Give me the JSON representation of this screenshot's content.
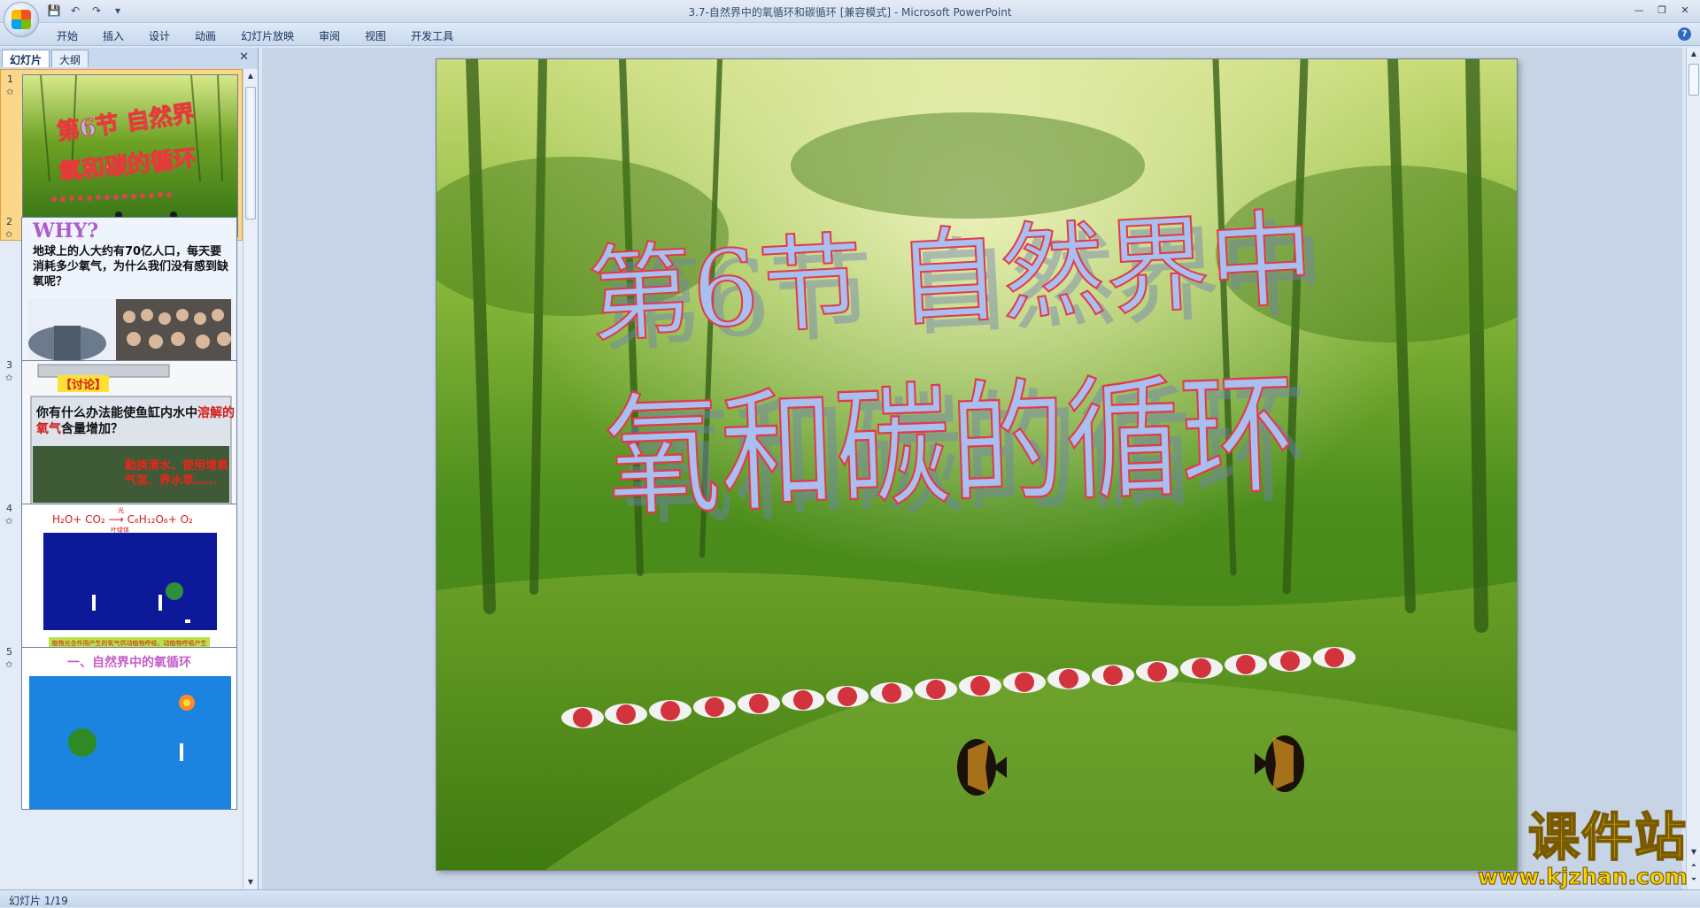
{
  "window": {
    "title": "3.7-自然界中的氧循环和碳循环 [兼容模式] - Microsoft PowerPoint"
  },
  "ribbon": {
    "tabs": [
      "开始",
      "插入",
      "设计",
      "动画",
      "幻灯片放映",
      "审阅",
      "视图",
      "开发工具"
    ]
  },
  "left_pane": {
    "tabs": [
      "幻灯片",
      "大纲"
    ],
    "slides": [
      {
        "num": "1",
        "selected": true
      },
      {
        "num": "2",
        "why": "WHY?",
        "question": "地球上的人大约有70亿人口，每天要消耗多少氧气，为什么我们没有感到缺氧呢？"
      },
      {
        "num": "3",
        "tag": "【讨论】",
        "question_a": "你有什么办法能使鱼缸内水中",
        "question_red": "溶解的氧气",
        "question_b": "含量增加？",
        "answer": "勤换清水、使用增氧气泵、养水草……"
      },
      {
        "num": "4",
        "equation": "H₂O+ CO₂ ⟶ C₆H₁₂O₆+ O₂",
        "eq_top": "光",
        "eq_bottom": "叶绿体",
        "note": "植物光合作用产生的氧气供动植物呼吸，动植物呼吸产生的二氧化碳供给植物光合作用"
      },
      {
        "num": "5",
        "title": "一、自然界中的氧循环"
      }
    ]
  },
  "slide": {
    "line1": "第6节 自然界中",
    "line2": "氧和碳的循环"
  },
  "status": {
    "text": "幻灯片 1/19"
  },
  "watermark": {
    "big": "课件站",
    "small": "www.kjzhan.com"
  }
}
